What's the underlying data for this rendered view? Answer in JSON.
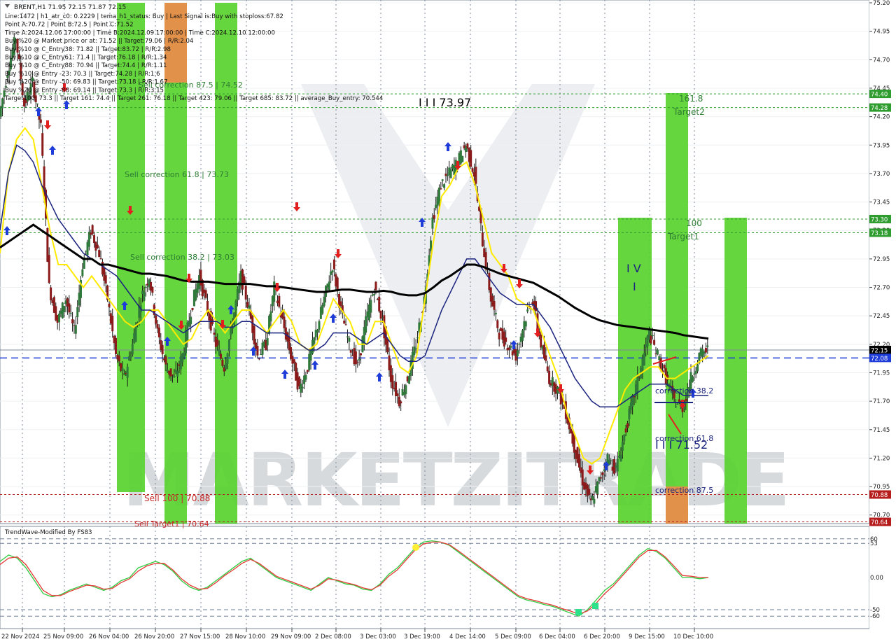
{
  "header": {
    "symbol_line": "BRENT,H1  71.95 72.15 71.87 72.15",
    "info_lines": [
      "Line:1472 | h1_atr_c0: 0.2229 | tema_h1_status: Buy | Last Signal is:Buy with stoploss:67.82",
      "Point A:70.72 | Point B:72.5 | Point C:71.52",
      "Time A:2024.12.06 17:00:00 | Time B:2024.12.09 17:00:00 | Time C:2024.12.10 12:00:00",
      "Buy %20 @ Market price or at: 71.52 || Target:79.06 | R/R:2.04",
      "Buy %10 @ C_Entry38: 71.82 || Target:83.72 | R/R:2.98",
      "Buy %10 @ C_Entry61: 71.4 || Target:76.18 | R/R:1.34",
      "Buy %10 @ C_Entry88: 70.94 || Target:74.4 | R/R:1.11",
      "Buy %10 @ Entry -23: 70.3 || Target:74.28 | R/R:1.6",
      "Buy %20 @ Entry -50: 69.83 || Target:73.18 | R/R:1.67",
      "Buy %20 @ Entry -88: 69.14 || Target:73.3 | R/R:3.15",
      "Target100: 73.3 || Target 161: 74.4 || Target 261: 76.18 || Target 423: 79.06 || Target 685: 83.72 || average_Buy_entry: 70.544"
    ]
  },
  "watermark": "MARKETZITRADE",
  "chart_annotations": [
    {
      "text": "I I I 73.97",
      "color": "#000000"
    },
    {
      "text": "Sell correction 61.8 | 73.73",
      "color": "#2e7d32"
    },
    {
      "text": "Sell correction 38.2 | 73.03",
      "color": "#2e7d32"
    },
    {
      "text": "Sell correction 87.5 | 74.52",
      "color": "#2e7d32"
    },
    {
      "text": "Sell 100 | 70.88",
      "color": "#c62828"
    },
    {
      "text": "Sell Target1 | 70.64",
      "color": "#c62828"
    },
    {
      "text": "161.8",
      "color": "#2e7d32"
    },
    {
      "text": "Target2",
      "color": "#2e7d32"
    },
    {
      "text": "100",
      "color": "#2e7d32"
    },
    {
      "text": "Target1",
      "color": "#2e7d32"
    },
    {
      "text": "I V",
      "color": "#1a237e"
    },
    {
      "text": "I",
      "color": "#1a237e"
    },
    {
      "text": "correction 38.2",
      "color": "#1a237e"
    },
    {
      "text": "correction 61.8",
      "color": "#1a237e"
    },
    {
      "text": "I I I 71.52",
      "color": "#1a237e"
    },
    {
      "text": "correction 87.5",
      "color": "#1a237e"
    }
  ],
  "price_tags": [
    {
      "value": "74.40",
      "color": "#2e9c2e"
    },
    {
      "value": "74.28",
      "color": "#2e9c2e"
    },
    {
      "value": "73.30",
      "color": "#2e9c2e"
    },
    {
      "value": "73.18",
      "color": "#2e9c2e"
    },
    {
      "value": "72.15",
      "color": "#000000"
    },
    {
      "value": "72.08",
      "color": "#1e3cd8"
    },
    {
      "value": "70.88",
      "color": "#b71c1c"
    },
    {
      "value": "70.64",
      "color": "#b71c1c"
    }
  ],
  "oscillator": {
    "title": "TrendWave-Modified By FS83",
    "axis_labels": [
      "60",
      "53",
      "0.00",
      "-50",
      "-60"
    ],
    "colors": {
      "fast": "#2ecc40",
      "slow": "#e53935",
      "level": "#6d7f96"
    }
  },
  "chart_data": [
    {
      "type": "candlestick",
      "title": "BRENT,H1",
      "y_axis_labels": [
        "75.20",
        "74.95",
        "74.70",
        "74.45",
        "74.20",
        "73.95",
        "73.70",
        "73.45",
        "73.20",
        "72.95",
        "72.70",
        "72.45",
        "72.20",
        "71.95",
        "71.70",
        "71.45",
        "71.20",
        "70.95",
        "70.70"
      ],
      "ylim": [
        70.6,
        75.2
      ],
      "x_tick_labels": [
        "22 Nov 2024",
        "25 Nov 09:00",
        "26 Nov 04:00",
        "26 Nov 20:00",
        "27 Nov 15:00",
        "28 Nov 10:00",
        "29 Nov 09:00",
        "2 Dec 08:00",
        "3 Dec 03:00",
        "3 Dec 19:00",
        "4 Dec 14:00",
        "5 Dec 09:00",
        "6 Dec 04:00",
        "6 Dec 20:00",
        "9 Dec 15:00",
        "10 Dec 10:00"
      ],
      "last_price": 72.15,
      "close_path": [
        74.2,
        74.6,
        74.9,
        74.3,
        74.5,
        74.1,
        72.7,
        72.4,
        72.6,
        72.3,
        72.9,
        73.2,
        73.0,
        72.6,
        72.1,
        71.9,
        72.2,
        72.6,
        72.8,
        72.3,
        72.0,
        71.9,
        72.1,
        72.5,
        72.8,
        72.5,
        72.2,
        72.0,
        72.4,
        72.8,
        72.5,
        72.1,
        72.2,
        72.7,
        72.4,
        72.1,
        71.8,
        72.0,
        72.3,
        72.6,
        72.9,
        72.5,
        72.2,
        72.0,
        72.4,
        72.7,
        72.4,
        71.9,
        71.7,
        71.9,
        72.2,
        72.6,
        73.3,
        73.6,
        73.7,
        73.8,
        73.95,
        73.7,
        73.1,
        72.6,
        72.3,
        72.2,
        72.1,
        72.4,
        72.6,
        72.2,
        71.9,
        71.8,
        71.6,
        71.3,
        71.0,
        70.8,
        71.0,
        71.2,
        71.1,
        71.4,
        71.7,
        72.0,
        72.3,
        72.1,
        71.9,
        71.7,
        71.65,
        71.9,
        72.1,
        72.15
      ],
      "series": [
        {
          "name": "tema",
          "color": "#ffea00",
          "values": [
            73.0,
            73.7,
            74.0,
            74.1,
            74.0,
            73.6,
            73.2,
            72.9,
            72.9,
            72.8,
            72.7,
            72.8,
            72.7,
            72.6,
            72.5,
            72.4,
            72.35,
            72.4,
            72.5,
            72.5,
            72.4,
            72.3,
            72.2,
            72.25,
            72.4,
            72.5,
            72.4,
            72.3,
            72.4,
            72.5,
            72.5,
            72.4,
            72.3,
            72.4,
            72.5,
            72.4,
            72.2,
            72.15,
            72.2,
            72.4,
            72.6,
            72.5,
            72.4,
            72.2,
            72.2,
            72.4,
            72.4,
            72.2,
            72.0,
            71.95,
            72.1,
            72.6,
            73.1,
            73.5,
            73.6,
            73.75,
            73.8,
            73.6,
            73.3,
            73.0,
            72.9,
            72.8,
            72.6,
            72.55,
            72.5,
            72.3,
            72.1,
            71.9,
            71.6,
            71.4,
            71.2,
            71.15,
            71.2,
            71.4,
            71.6,
            71.8,
            71.9,
            71.95,
            72.0,
            72.0,
            71.9,
            71.9,
            71.95,
            72.0,
            72.05,
            72.1
          ]
        },
        {
          "name": "ema_fast",
          "color": "#1a237e",
          "values": [
            73.2,
            73.7,
            73.95,
            73.9,
            73.8,
            73.6,
            73.45,
            73.3,
            73.2,
            73.1,
            73.0,
            72.95,
            72.9,
            72.85,
            72.8,
            72.7,
            72.6,
            72.5,
            72.5,
            72.45,
            72.4,
            72.35,
            72.3,
            72.35,
            72.4,
            72.4,
            72.4,
            72.35,
            72.35,
            72.4,
            72.4,
            72.35,
            72.3,
            72.3,
            72.3,
            72.25,
            72.2,
            72.15,
            72.15,
            72.2,
            72.3,
            72.3,
            72.3,
            72.25,
            72.2,
            72.25,
            72.3,
            72.2,
            72.1,
            72.05,
            72.05,
            72.1,
            72.3,
            72.5,
            72.65,
            72.8,
            72.95,
            72.95,
            72.85,
            72.75,
            72.65,
            72.6,
            72.55,
            72.55,
            72.55,
            72.45,
            72.35,
            72.2,
            72.05,
            71.9,
            71.8,
            71.7,
            71.65,
            71.65,
            71.65,
            71.7,
            71.75,
            71.8,
            71.85,
            71.85,
            71.85,
            71.8,
            71.75,
            71.75,
            71.75,
            71.75
          ]
        },
        {
          "name": "ema_slow",
          "color": "#000000",
          "values": [
            73.05,
            73.1,
            73.15,
            73.2,
            73.25,
            73.2,
            73.15,
            73.1,
            73.05,
            73.0,
            72.95,
            72.95,
            72.9,
            72.9,
            72.88,
            72.86,
            72.84,
            72.82,
            72.82,
            72.81,
            72.8,
            72.78,
            72.76,
            72.75,
            72.75,
            72.75,
            72.74,
            72.73,
            72.73,
            72.73,
            72.73,
            72.72,
            72.71,
            72.71,
            72.7,
            72.69,
            72.68,
            72.67,
            72.66,
            72.66,
            72.67,
            72.68,
            72.68,
            72.67,
            72.66,
            72.66,
            72.67,
            72.66,
            72.64,
            72.63,
            72.63,
            72.65,
            72.7,
            72.76,
            72.8,
            72.85,
            72.9,
            72.9,
            72.88,
            72.85,
            72.82,
            72.8,
            72.78,
            72.76,
            72.74,
            72.7,
            72.66,
            72.62,
            72.57,
            72.52,
            72.48,
            72.44,
            72.41,
            72.39,
            72.37,
            72.36,
            72.35,
            72.34,
            72.33,
            72.32,
            72.31,
            72.3,
            72.28,
            72.27,
            72.26,
            72.25
          ]
        }
      ],
      "reference_lines": [
        {
          "name": "Target2",
          "value": 74.4
        },
        {
          "name": "74.28",
          "value": 74.28
        },
        {
          "name": "Target1",
          "value": 73.3
        },
        {
          "name": "73.18",
          "value": 73.18
        },
        {
          "name": "72.15",
          "value": 72.15
        },
        {
          "name": "72.08",
          "value": 72.08
        },
        {
          "name": "Sell 100",
          "value": 70.88
        },
        {
          "name": "Sell Target1",
          "value": 70.64
        }
      ]
    },
    {
      "type": "line",
      "title": "TrendWave-Modified By FS83",
      "ylim": [
        -80,
        80
      ],
      "levels": [
        60,
        53,
        -50,
        -60
      ],
      "series": [
        {
          "name": "fast",
          "values": [
            25,
            35,
            30,
            15,
            -5,
            -25,
            -30,
            -27,
            -20,
            -15,
            -10,
            -15,
            -20,
            -15,
            -5,
            0,
            15,
            20,
            25,
            20,
            10,
            -5,
            -15,
            -20,
            -15,
            -5,
            5,
            15,
            25,
            30,
            20,
            10,
            0,
            -5,
            -10,
            -15,
            -20,
            -10,
            0,
            -5,
            -10,
            -12,
            -18,
            -20,
            -10,
            5,
            15,
            30,
            45,
            55,
            57,
            55,
            50,
            40,
            30,
            20,
            10,
            0,
            -10,
            -20,
            -30,
            -35,
            -38,
            -42,
            -45,
            -50,
            -55,
            -60,
            -50,
            -35,
            -20,
            -10,
            5,
            20,
            35,
            45,
            40,
            30,
            15,
            0,
            0,
            -2,
            0
          ]
        },
        {
          "name": "slow",
          "values": [
            20,
            30,
            32,
            20,
            0,
            -20,
            -28,
            -28,
            -22,
            -17,
            -12,
            -13,
            -18,
            -17,
            -8,
            -2,
            10,
            18,
            22,
            22,
            12,
            -2,
            -12,
            -18,
            -17,
            -8,
            3,
            12,
            22,
            28,
            22,
            12,
            2,
            -3,
            -8,
            -13,
            -18,
            -12,
            -2,
            -4,
            -8,
            -11,
            -16,
            -19,
            -12,
            2,
            12,
            27,
            42,
            52,
            55,
            55,
            51,
            42,
            32,
            22,
            12,
            2,
            -8,
            -18,
            -28,
            -33,
            -36,
            -40,
            -43,
            -48,
            -52,
            -57,
            -52,
            -40,
            -25,
            -13,
            2,
            17,
            32,
            42,
            42,
            32,
            18,
            3,
            2,
            0,
            0
          ]
        }
      ]
    }
  ]
}
